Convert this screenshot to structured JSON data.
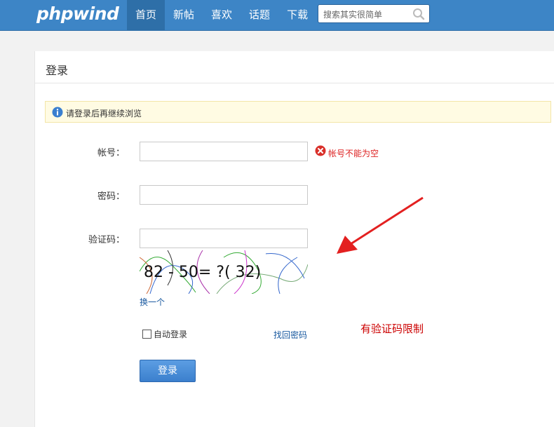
{
  "header": {
    "logo": "phpwind",
    "nav": [
      "首页",
      "新帖",
      "喜欢",
      "话题",
      "下载"
    ],
    "active_nav": "首页",
    "search_placeholder": "搜索其实很简单",
    "colors": {
      "bar": "#3d85c6",
      "active": "#2e6fa8"
    }
  },
  "page": {
    "title": "登录",
    "notice": "请登录后再继续浏览"
  },
  "form": {
    "account_label": "帐号：",
    "account_value": "",
    "account_error": "帐号不能为空",
    "password_label": "密码：",
    "password_value": "",
    "captcha_label": "验证码：",
    "captcha_value": "",
    "captcha_image_text": "82 - 50= ?( 32)",
    "change_captcha": "换一个",
    "remember_label": "自动登录",
    "forgot_label": "找回密码",
    "submit_label": "登录"
  },
  "annotation": {
    "text": "有验证码限制",
    "color": "#cc0000"
  }
}
